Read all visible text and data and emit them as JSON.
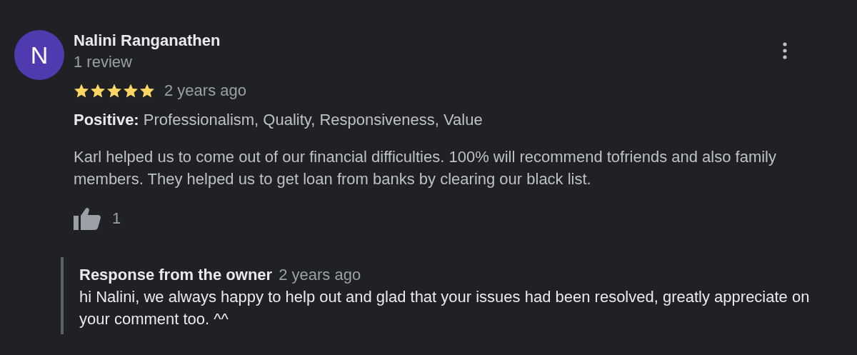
{
  "review": {
    "avatar_letter": "N",
    "author": "Nalini Ranganathen",
    "author_meta": "1 review",
    "stars": 5,
    "time": "2 years ago",
    "highlights": "**Positive:** Professionalism, Quality, Responsiveness, Value",
    "text": "Karl helped us to come out of our financial difficulties. 100% will recommend tofriends and also family members. They helped us to get loan from banks by clearing our black list.",
    "likes": "1"
  },
  "owner_response": {
    "label": "Response from the owner",
    "time": "2 years ago",
    "text": "hi Nalini, we always happy to help out and glad that your issues had been resolved, greatly appreciate on your comment too. ^^"
  }
}
